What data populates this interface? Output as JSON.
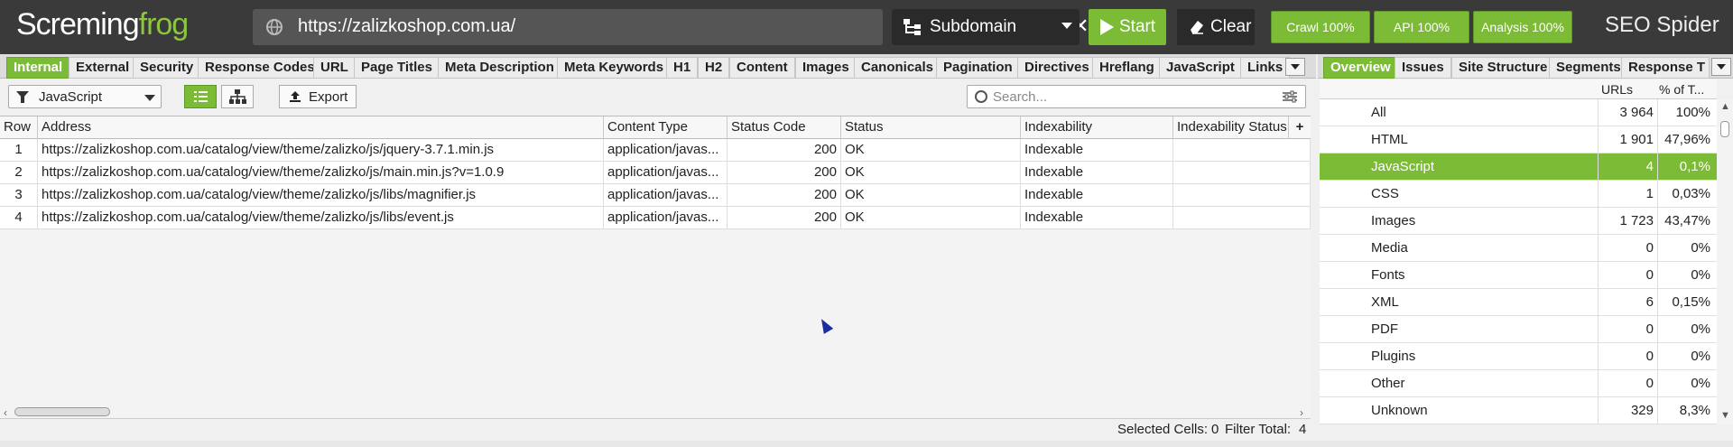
{
  "app": {
    "logo_text_1": "Scre",
    "logo_text_2": "ming",
    "logo_text_3": "frog",
    "product": "SEO Spider",
    "accent": "#7cbb36"
  },
  "top": {
    "url": "https://zalizkoshop.com.ua/",
    "mode_label": "Subdomain",
    "start_label": "Start",
    "clear_label": "Clear",
    "progress": [
      {
        "label": "Crawl 100%",
        "value": 1.0
      },
      {
        "label": "API 100%",
        "value": 1.0
      },
      {
        "label": "Analysis 100%",
        "value": 1.0
      }
    ]
  },
  "tabs": [
    "Internal",
    "External",
    "Security",
    "Response Codes",
    "URL",
    "Page Titles",
    "Meta Description",
    "Meta Keywords",
    "H1",
    "H2",
    "Content",
    "Images",
    "Canonicals",
    "Pagination",
    "Directives",
    "Hreflang",
    "JavaScript",
    "Links"
  ],
  "active_tab": "Internal",
  "right_tabs": [
    "Overview",
    "Issues",
    "Site Structure",
    "Segments",
    "Response T"
  ],
  "right_active_tab": "Overview",
  "toolbar": {
    "filter_label": "JavaScript",
    "export_label": "Export",
    "search_placeholder": "Search..."
  },
  "table": {
    "columns": [
      "Row",
      "Address",
      "Content Type",
      "Status Code",
      "Status",
      "Indexability",
      "Indexability Status"
    ],
    "rows": [
      {
        "row": "1",
        "address": "https://zalizkoshop.com.ua/catalog/view/theme/zalizko/js/jquery-3.7.1.min.js",
        "content_type": "application/javas...",
        "status_code": "200",
        "status": "OK",
        "indexability": "Indexable",
        "indexability_status": ""
      },
      {
        "row": "2",
        "address": "https://zalizkoshop.com.ua/catalog/view/theme/zalizko/js/main.min.js?v=1.0.9",
        "content_type": "application/javas...",
        "status_code": "200",
        "status": "OK",
        "indexability": "Indexable",
        "indexability_status": ""
      },
      {
        "row": "3",
        "address": "https://zalizkoshop.com.ua/catalog/view/theme/zalizko/js/libs/magnifier.js",
        "content_type": "application/javas...",
        "status_code": "200",
        "status": "OK",
        "indexability": "Indexable",
        "indexability_status": ""
      },
      {
        "row": "4",
        "address": "https://zalizkoshop.com.ua/catalog/view/theme/zalizko/js/libs/event.js",
        "content_type": "application/javas...",
        "status_code": "200",
        "status": "OK",
        "indexability": "Indexable",
        "indexability_status": ""
      }
    ]
  },
  "status": {
    "selected_cells_label": "Selected Cells:",
    "selected_cells": "0",
    "filter_total_label": "Filter Total:",
    "filter_total": "4"
  },
  "overview": {
    "col_urls": "URLs",
    "col_pct": "% of T...",
    "rows": [
      {
        "label": "All",
        "urls": "3 964",
        "pct": "100%"
      },
      {
        "label": "HTML",
        "urls": "1 901",
        "pct": "47,96%"
      },
      {
        "label": "JavaScript",
        "urls": "4",
        "pct": "0,1%"
      },
      {
        "label": "CSS",
        "urls": "1",
        "pct": "0,03%"
      },
      {
        "label": "Images",
        "urls": "1 723",
        "pct": "43,47%"
      },
      {
        "label": "Media",
        "urls": "0",
        "pct": "0%"
      },
      {
        "label": "Fonts",
        "urls": "0",
        "pct": "0%"
      },
      {
        "label": "XML",
        "urls": "6",
        "pct": "0,15%"
      },
      {
        "label": "PDF",
        "urls": "0",
        "pct": "0%"
      },
      {
        "label": "Plugins",
        "urls": "0",
        "pct": "0%"
      },
      {
        "label": "Other",
        "urls": "0",
        "pct": "0%"
      },
      {
        "label": "Unknown",
        "urls": "329",
        "pct": "8,3%"
      }
    ],
    "selected": "JavaScript"
  }
}
